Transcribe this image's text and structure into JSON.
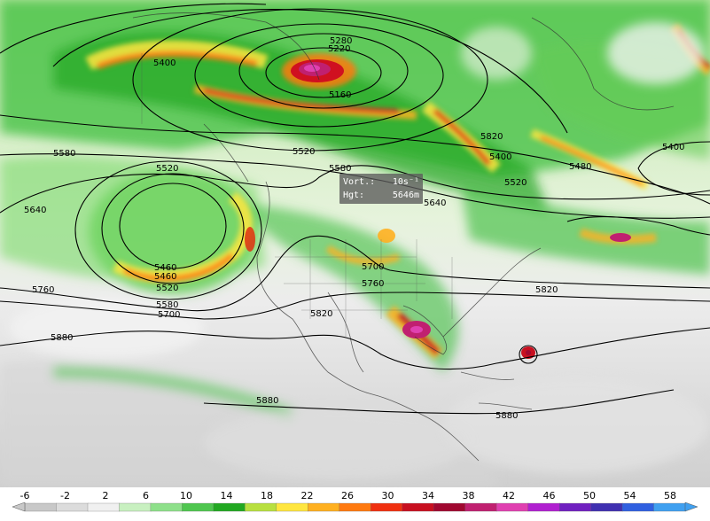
{
  "map": {
    "contour_labels": [
      "5400",
      "5280",
      "5220",
      "5160",
      "5580",
      "5520",
      "5640",
      "5460",
      "5460",
      "5520",
      "5580",
      "5700",
      "5760",
      "5820",
      "5820",
      "5880",
      "5880",
      "5880",
      "5580",
      "5640",
      "5700",
      "5760",
      "5520",
      "5400",
      "5480",
      "5520",
      "5820",
      "5400"
    ],
    "readout": {
      "vort_label": "Vort.:",
      "vort_value": "10s⁻¹",
      "hgt_label": "Hgt:",
      "hgt_value": "5646m"
    }
  },
  "colorbar": {
    "ticks": [
      "-6",
      "-2",
      "2",
      "6",
      "10",
      "14",
      "18",
      "22",
      "26",
      "30",
      "34",
      "38",
      "42",
      "46",
      "50",
      "54",
      "58"
    ],
    "colors": [
      "#c8c8c8",
      "#dcdcdc",
      "#f0f0f0",
      "#c8f0c0",
      "#8ee08a",
      "#4fc64f",
      "#22a822",
      "#b8e040",
      "#ffe640",
      "#ffb020",
      "#ff7a10",
      "#f03010",
      "#c81020",
      "#a00830",
      "#c02070",
      "#e040b0",
      "#b020d0",
      "#7020c0",
      "#4030b0",
      "#3060e0",
      "#40a0f0"
    ]
  }
}
